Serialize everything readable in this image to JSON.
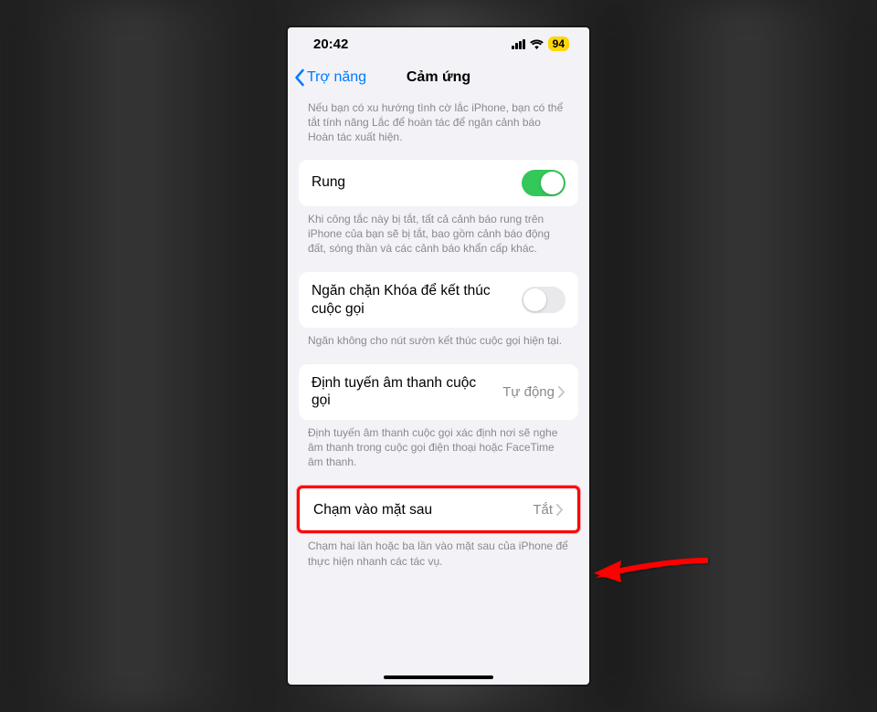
{
  "status": {
    "time": "20:42",
    "battery": "94"
  },
  "nav": {
    "back": "Trợ năng",
    "title": "Cảm ứng"
  },
  "intro_footer": "Nếu bạn có xu hướng tình cờ lắc iPhone, bạn có thể tắt tính năng Lắc để hoàn tác để ngăn cảnh báo Hoàn tác xuất hiện.",
  "rung": {
    "label": "Rung",
    "footer": "Khi công tắc này bị tắt, tất cả cảnh báo rung trên iPhone của bạn sẽ bị tắt, bao gồm cảnh báo động đất, sóng thần và các cảnh báo khẩn cấp khác."
  },
  "lock": {
    "label": "Ngăn chặn Khóa để kết thúc cuộc gọi",
    "footer": "Ngăn không cho nút sườn kết thúc cuộc gọi hiện tại."
  },
  "audio": {
    "label": "Định tuyến âm thanh cuộc gọi",
    "value": "Tự động",
    "footer": "Định tuyến âm thanh cuộc gọi xác định nơi sẽ nghe âm thanh trong cuộc gọi điện thoại hoặc FaceTime âm thanh."
  },
  "backtap": {
    "label": "Chạm vào mặt sau",
    "value": "Tắt",
    "footer": "Chạm hai lần hoặc ba lần vào mặt sau của iPhone để thực hiện nhanh các tác vụ."
  }
}
